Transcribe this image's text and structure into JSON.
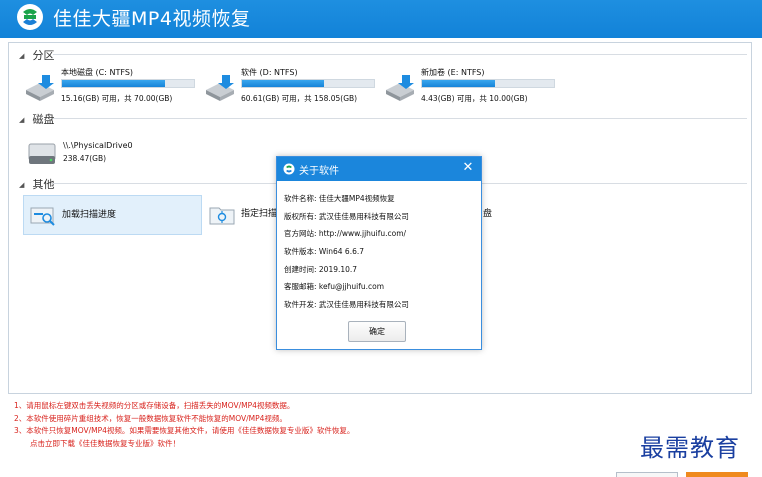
{
  "app": {
    "title": "佳佳大疆MP4视频恢复",
    "colors": {
      "titlebar": "#1a88dc",
      "progress": "#1e8ce0",
      "notes": "#d8221c"
    }
  },
  "sections": {
    "partition": "分区",
    "disk": "磁盘",
    "other": "其他"
  },
  "partitions": [
    {
      "name": "本地磁盘 (C: NTFS)",
      "usage": "15.16(GB) 可用，共 70.00(GB)",
      "fill": 0.78,
      "icon": "drive-icon"
    },
    {
      "name": "软件 (D: NTFS)",
      "usage": "60.61(GB) 可用，共 158.05(GB)",
      "fill": 0.62,
      "icon": "drive-icon"
    },
    {
      "name": "新加卷 (E: NTFS)",
      "usage": "4.43(GB) 可用，共 10.00(GB)",
      "fill": 0.55,
      "icon": "drive-icon"
    }
  ],
  "disks": [
    {
      "name": "\\\\.\\PhysicalDrive0",
      "size": "238.47(GB)",
      "icon": "hard-disk-icon"
    }
  ],
  "other": [
    {
      "label": "加载扫描进度",
      "icon": "load-scan-icon"
    },
    {
      "label": "指定扫描",
      "icon": "specify-scan-icon"
    },
    {
      "label": "盘",
      "icon": "disk-icon"
    }
  ],
  "notes": [
    "1、请用鼠标左键双击丢失视频的分区或存储设备，扫描丢失的MOV/MP4视频数据。",
    "2、本软件使用碎片重组技术，恢复一般数据恢复软件不能恢复的MOV/MP4视频。",
    "3、本软件只恢复MOV/MP4视频。如果需要恢复其他文件，请使用《佳佳数据恢复专业版》软件恢复。",
    "点击立即下载《佳佳数据恢复专业版》软件！"
  ],
  "watermark": "最需教育",
  "about_dialog": {
    "title": "关于软件",
    "rows": [
      "软件名称: 佳佳大疆MP4视频恢复",
      "版权所有: 武汉佳佳易用科技有限公司",
      "官方网站: http://www.jjhuifu.com/",
      "软件版本: Win64 6.6.7",
      "创建时间: 2019.10.7",
      "客服邮箱: kefu@jjhuifu.com",
      "软件开发: 武汉佳佳易用科技有限公司"
    ],
    "ok_label": "确定",
    "close_glyph": "✕"
  }
}
